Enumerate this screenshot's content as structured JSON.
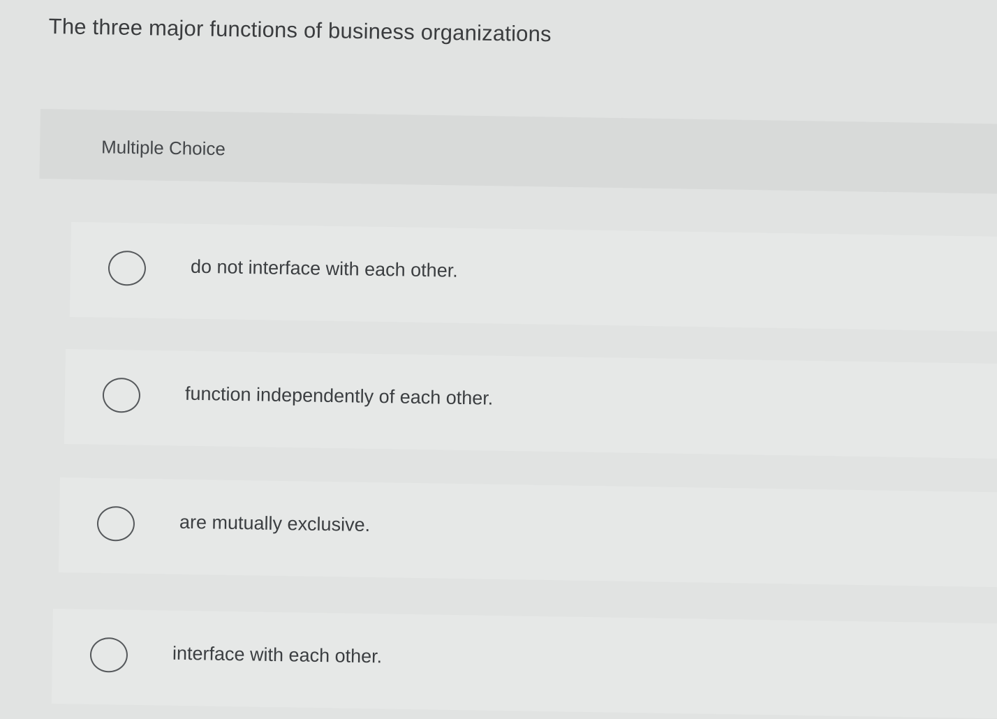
{
  "question": {
    "text": "The three major functions of business organizations"
  },
  "choice_header": {
    "label": "Multiple Choice"
  },
  "options": [
    {
      "text": "do not interface with each other."
    },
    {
      "text": "function independently of each other."
    },
    {
      "text": "are mutually exclusive."
    },
    {
      "text": "interface with each other."
    }
  ]
}
